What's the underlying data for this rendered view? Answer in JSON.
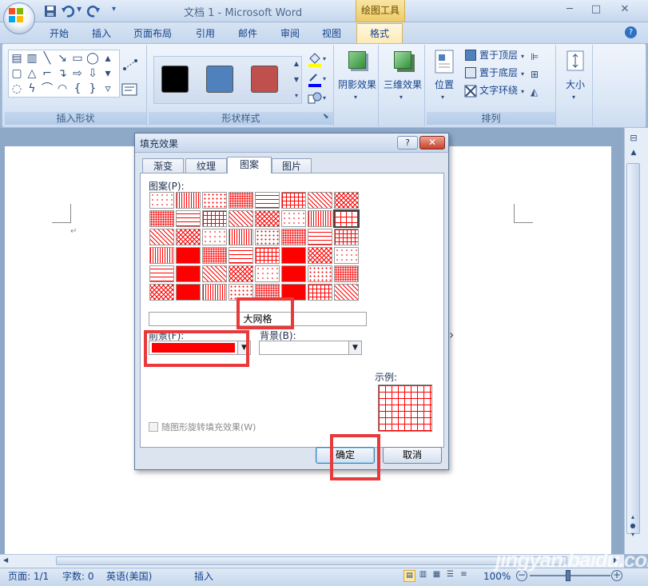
{
  "window": {
    "title": "文档 1 - Microsoft Word",
    "context_tab_group": "绘图工具",
    "min_glyph": "─",
    "max_glyph": "□",
    "close_glyph": "✕"
  },
  "ribbon_tabs": [
    "开始",
    "插入",
    "页面布局",
    "引用",
    "邮件",
    "审阅",
    "视图",
    "格式"
  ],
  "ribbon": {
    "insert_shapes_group": "插入形状",
    "shape_styles_group": "形状样式",
    "shape_style_colors": [
      "#000000",
      "#4f81bd",
      "#c0504d"
    ],
    "shadow_effects": "阴影效果",
    "threed_effects": "三维效果",
    "position": "位置",
    "bring_to_front": "置于顶层",
    "send_to_back": "置于底层",
    "text_wrapping": "文字环绕",
    "arrange_group": "排列",
    "size": "大小"
  },
  "dialog": {
    "title": "填充效果",
    "help": "?",
    "close": "✕",
    "tabs": [
      "渐变",
      "纹理",
      "图案",
      "图片"
    ],
    "active_tab": "图案",
    "pattern_label": "图案(P):",
    "selected_pattern_name": "大网格",
    "foreground_label": "前景(F):",
    "foreground_color": "#ff0000",
    "background_label": "背景(B):",
    "sample_label": "示例:",
    "rotate_checkbox_label": "随图形旋转填充效果(W)",
    "ok": "确定",
    "cancel": "取消"
  },
  "status_bar": {
    "page": "页面: 1/1",
    "words": "字数: 0",
    "language": "英语(美国)",
    "mode": "插入",
    "zoom": "100%"
  },
  "watermark": "Bai 经验 jingyan.baidu.com"
}
